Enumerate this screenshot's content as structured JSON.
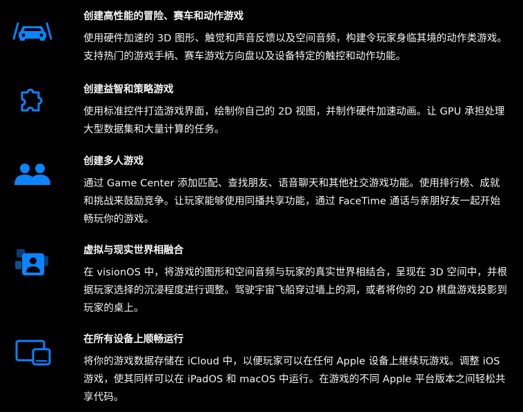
{
  "accent_color": "#0a84ff",
  "features": [
    {
      "icon": "car-icon",
      "title": "创建高性能的冒险、赛车和动作游戏",
      "description": "使用硬件加速的 3D 图形、触觉和声音反馈以及空间音频，构建令玩家身临其境的动作类游戏。支持热门的游戏手柄、赛车游戏方向盘以及设备特定的触控和动作功能。"
    },
    {
      "icon": "puzzle-icon",
      "title": "创建益智和策略游戏",
      "description": "使用标准控件打造游戏界面，绘制你自己的 2D 视图，并制作硬件加速动画。让 GPU 承担处理大型数据集和大量计算的任务。"
    },
    {
      "icon": "people-icon",
      "title": "创建多人游戏",
      "description": "通过 Game Center 添加匹配、查找朋友、语音聊天和其他社交游戏功能。使用排行榜、成就和挑战来鼓励竞争。让玩家能够使用同播共享功能，通过 FaceTime 通话与亲朋好友一起开始畅玩你的游戏。"
    },
    {
      "icon": "person-spatial-icon",
      "title": "虚拟与现实世界相融合",
      "description": "在 visionOS 中，将游戏的图形和空间音频与玩家的真实世界相结合，呈现在 3D 空间中，并根据玩家选择的沉浸程度进行调整。驾驶宇宙飞船穿过墙上的洞，或者将你的 2D 棋盘游戏投影到玩家的桌上。"
    },
    {
      "icon": "devices-icon",
      "title": "在所有设备上顺畅运行",
      "description": "将你的游戏数据存储在 iCloud 中，以便玩家可以在任何 Apple 设备上继续玩游戏。调整 iOS 游戏，使其同样可以在 iPadOS 和 macOS 中运行。在游戏的不同 Apple 平台版本之间轻松共享代码。"
    }
  ]
}
